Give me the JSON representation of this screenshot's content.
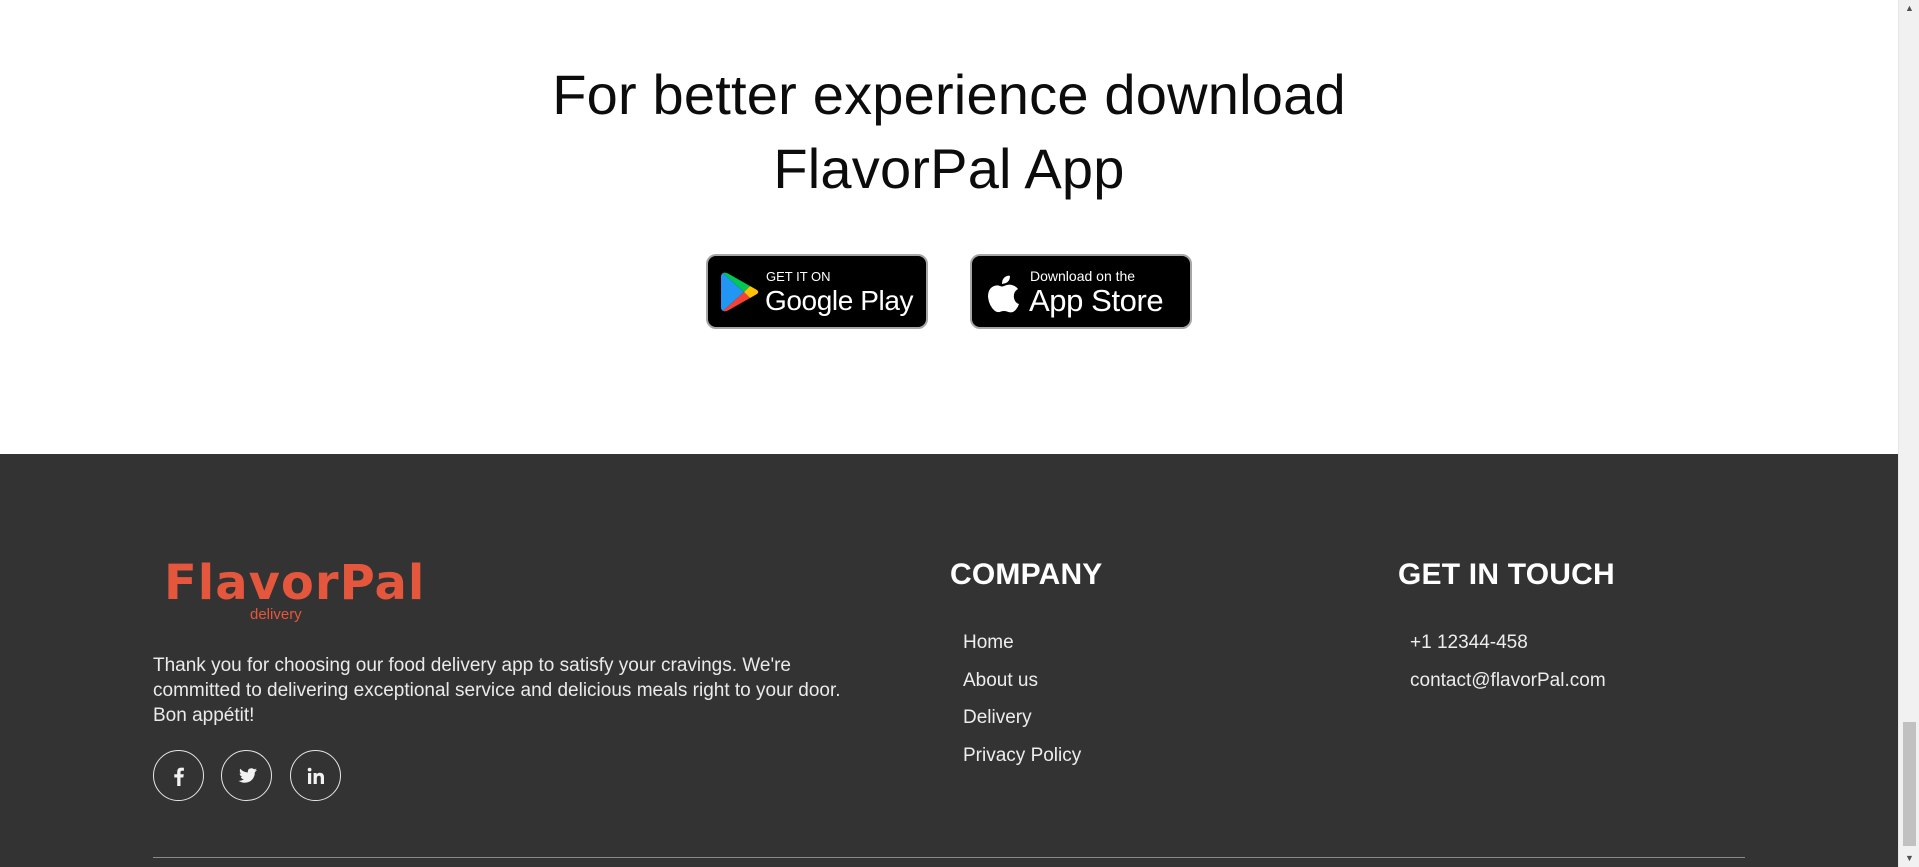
{
  "download": {
    "title_line1": "For better experience download",
    "title_line2": "FlavorPal App",
    "google_play": {
      "small": "GET IT ON",
      "big": "Google Play"
    },
    "app_store": {
      "small": "Download on the",
      "big": "App Store"
    }
  },
  "footer": {
    "logo": {
      "name": "FlavorPal",
      "tagline": "delivery"
    },
    "about": "Thank you for choosing our food delivery app to satisfy your cravings. We're committed to delivering exceptional service and delicious meals right to your door. Bon appétit!",
    "social": [
      "facebook-icon",
      "twitter-icon",
      "linkedin-icon"
    ],
    "company": {
      "heading": "COMPANY",
      "links": [
        "Home",
        "About us",
        "Delivery",
        "Privacy Policy"
      ]
    },
    "touch": {
      "heading": "GET IN TOUCH",
      "phone": "+1 12344-458",
      "email": "contact@flavorPal.com"
    }
  },
  "colors": {
    "accent": "#e4573c",
    "footer_bg": "#333333",
    "page_bg": "#ffffff"
  }
}
